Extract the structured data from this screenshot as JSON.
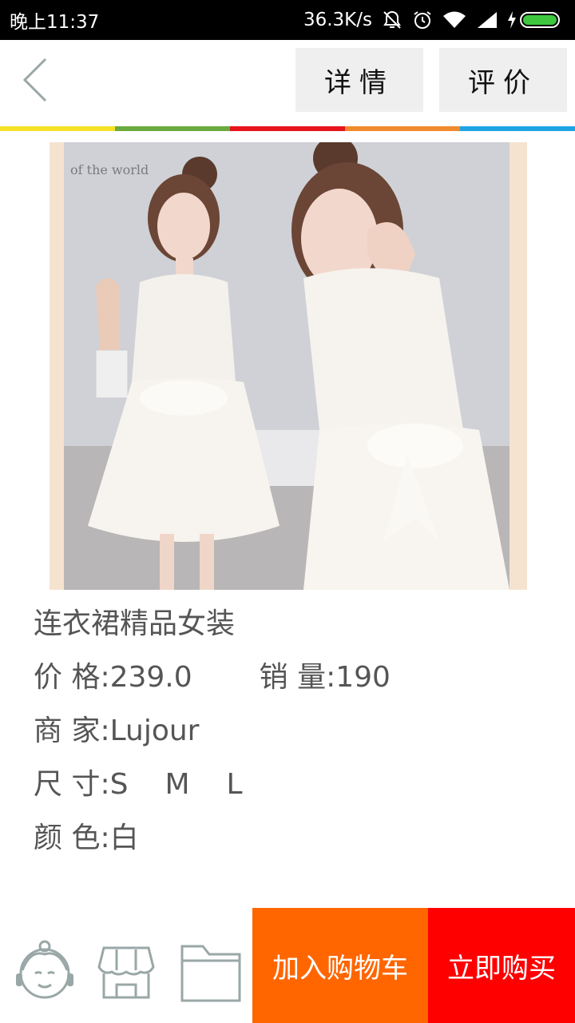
{
  "status_bar": {
    "time": "晚上11:37",
    "network_speed": "36.3K/s",
    "icons": [
      "mute-icon",
      "alarm-icon",
      "wifi-icon",
      "signal-icon",
      "battery-charging-icon"
    ]
  },
  "header": {
    "back_icon": "chevron-left-icon",
    "tabs": [
      {
        "label": "详情"
      },
      {
        "label": "评价"
      }
    ],
    "color_strip": [
      "#f5e12a",
      "#6aaa3e",
      "#e8141b",
      "#f08a2c",
      "#1fa3e3"
    ]
  },
  "product": {
    "image_alt": "product-photo",
    "name": "连衣裙精品女装",
    "price_label": "价 格:",
    "price": "239.0",
    "sales_label": "销 量:",
    "sales": "190",
    "seller_label": "商 家:",
    "seller": "Lujour",
    "size_label": "尺 寸:",
    "sizes": [
      "S",
      "M",
      "L"
    ],
    "color_label": "颜 色:",
    "color": "白"
  },
  "bottom_bar": {
    "icons": [
      "customer-service-icon",
      "shop-icon",
      "folder-icon"
    ],
    "add_to_cart": "加入购物车",
    "buy_now": "立即购买",
    "cart_color": "#ff6600",
    "buy_color": "#ff0000"
  }
}
